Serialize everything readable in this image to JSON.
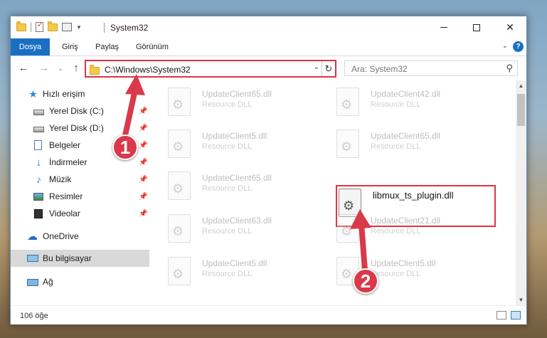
{
  "window": {
    "title": "System32"
  },
  "ribbon": {
    "tabs": [
      "Dosya",
      "Giriş",
      "Paylaş",
      "Görünüm"
    ],
    "help": "?"
  },
  "navigation": {
    "address": "C:\\Windows\\System32",
    "search_placeholder": "Ara: System32"
  },
  "sidebar": {
    "items": [
      {
        "label": "Hızlı erişim",
        "icon": "star-icon"
      },
      {
        "label": "Yerel Disk (C:)",
        "icon": "drive-icon",
        "pinned": true
      },
      {
        "label": "Yerel Disk (D:)",
        "icon": "drive-icon",
        "pinned": true
      },
      {
        "label": "Belgeler",
        "icon": "documents-icon",
        "pinned": true
      },
      {
        "label": "İndirmeler",
        "icon": "download-icon",
        "pinned": true
      },
      {
        "label": "Müzik",
        "icon": "music-icon",
        "pinned": true
      },
      {
        "label": "Resimler",
        "icon": "pictures-icon",
        "pinned": true
      },
      {
        "label": "Videolar",
        "icon": "videos-icon",
        "pinned": true
      },
      {
        "label": "OneDrive",
        "icon": "onedrive-icon"
      },
      {
        "label": "Bu bilgisayar",
        "icon": "this-pc-icon",
        "selected": true
      },
      {
        "label": "Ağ",
        "icon": "network-icon"
      }
    ]
  },
  "files": [
    {
      "name": "UpdateClient65.dll",
      "type": "Resource DLL"
    },
    {
      "name": "UpdateClient42.dll",
      "type": "Resource DLL"
    },
    {
      "name": "UpdateClient5.dll",
      "type": "Resource DLL"
    },
    {
      "name": "UpdateClient65.dll",
      "type": "Resource DLL"
    },
    {
      "name": "UpdateClient65.dll",
      "type": "Resource DLL"
    },
    {
      "name": "libmux_ts_plugin.dll",
      "type": "",
      "highlighted": true
    },
    {
      "name": "UpdateClient63.dll",
      "type": "Resource DLL"
    },
    {
      "name": "UpdateClient21.dll",
      "type": "Resource DLL"
    },
    {
      "name": "UpdateClient5.dll",
      "type": "Resource DLL"
    },
    {
      "name": "UpdateClient5.dll",
      "type": "Resource DLL"
    }
  ],
  "status": {
    "count": "106 öğe"
  },
  "callouts": [
    "1",
    "2"
  ],
  "colors": {
    "accent": "#1a6fc4",
    "highlight": "#dc3545",
    "callout": "#d9394a"
  }
}
